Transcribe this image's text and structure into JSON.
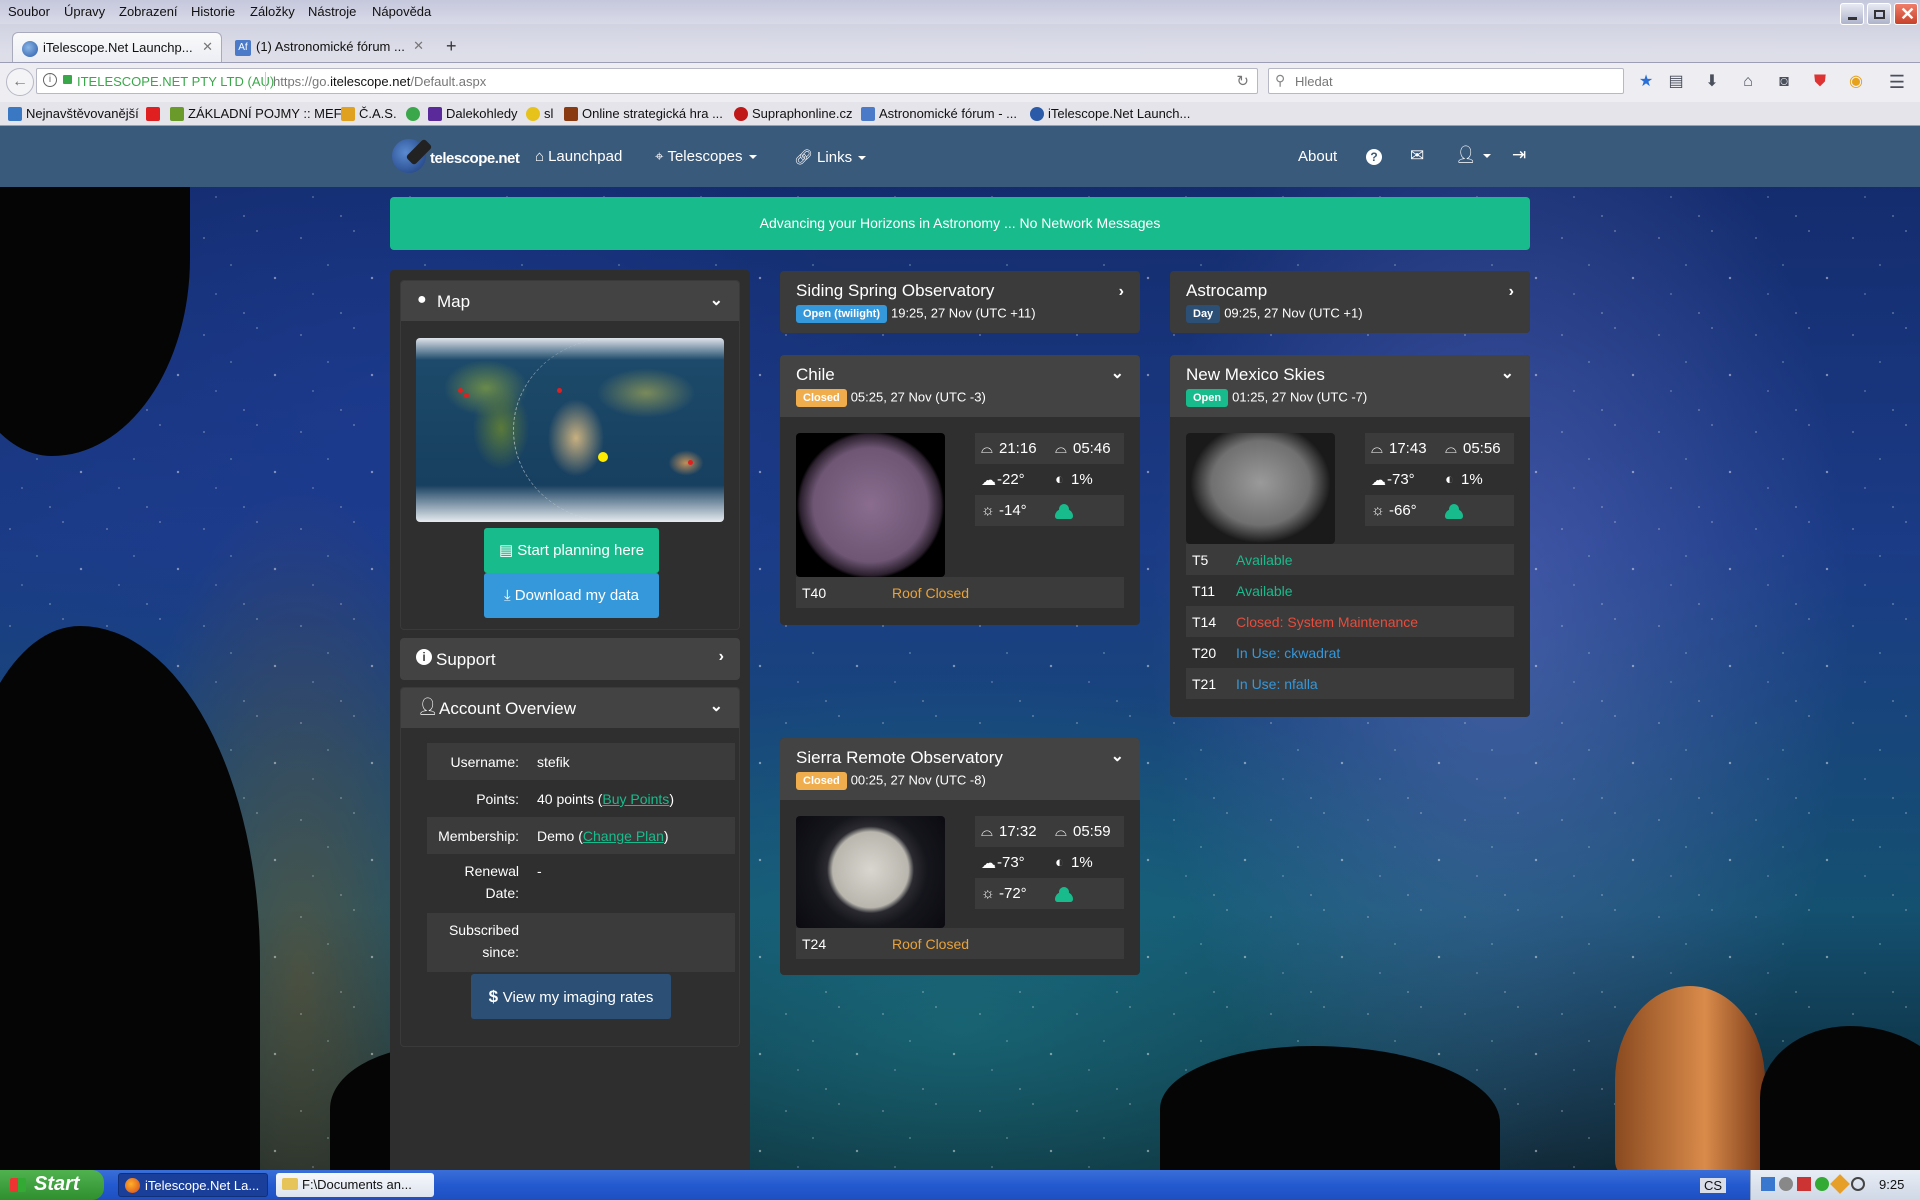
{
  "browser": {
    "menu": [
      "Soubor",
      "Úpravy",
      "Zobrazení",
      "Historie",
      "Záložky",
      "Nástroje",
      "Nápověda"
    ],
    "tabs": [
      {
        "label": "iTelescope.Net Launchp...",
        "active": true
      },
      {
        "label": "(1) Astronomické fórum ...",
        "active": false
      }
    ],
    "new_tab": "+",
    "identity": "ITELESCOPE.NET PTY LTD (AU)",
    "url_prefix": "https://go.",
    "url_domain": "itelescope.net",
    "url_path": "/Default.aspx",
    "search_placeholder": "Hledat",
    "bookmarks": [
      {
        "label": "Nejnavštěvovanější",
        "color": "#3b78c4"
      },
      {
        "label": "",
        "color": "#e02020"
      },
      {
        "label": "ZÁKLADNÍ POJMY :: MEF",
        "color": "#6a9a2a"
      },
      {
        "label": "Č.A.S.",
        "color": "#e0a020"
      },
      {
        "label": "",
        "color": "#3aa84a"
      },
      {
        "label": "Dalekohledy",
        "color": "#5a2a9a"
      },
      {
        "label": "sl",
        "color": "#e6c21a"
      },
      {
        "label": "Online strategická hra ...",
        "color": "#8a3a10"
      },
      {
        "label": "Supraphonline.cz",
        "color": "#c01818"
      },
      {
        "label": "Astronomické fórum - ...",
        "color": "#4a7ac8"
      },
      {
        "label": "iTelescope.Net Launch...",
        "color": "#2a5aa8"
      }
    ]
  },
  "nav": {
    "logo_text": "telescope.net",
    "items": [
      {
        "label": "Launchpad",
        "icon": "home-icon"
      },
      {
        "label": "Telescopes",
        "icon": "telescope-icon",
        "dropdown": true
      },
      {
        "label": "Links",
        "icon": "link-icon",
        "dropdown": true
      }
    ],
    "right": {
      "about": "About"
    }
  },
  "banner": "Advancing your Horizons in Astronomy ... No Network Messages",
  "sidebar": {
    "map_title": "Map",
    "start_planning": "Start planning here",
    "download_data": "Download my data",
    "support_title": "Support",
    "account_title": "Account Overview",
    "account": {
      "username_label": "Username:",
      "username": "stefik",
      "points_label": "Points:",
      "points_value": "40 points (",
      "buy_points": "Buy Points",
      "close_paren": ")",
      "membership_label": "Membership:",
      "membership_value": "Demo (",
      "change_plan": "Change Plan",
      "renewal_label_1": "Renewal",
      "renewal_label_2": "Date:",
      "renewal_value": "-",
      "subscribed_label_1": "Subscribed",
      "subscribed_label_2": "since:",
      "subscribed_value": ""
    },
    "view_rates": "View my imaging rates"
  },
  "observatories": {
    "siding": {
      "name": "Siding Spring Observatory",
      "status": "Open (twilight)",
      "status_color": "#3498db",
      "time": "19:25, 27 Nov (UTC +11)"
    },
    "astrocamp": {
      "name": "Astrocamp",
      "status": "Day",
      "status_color": "#2c4f75",
      "time": "09:25, 27 Nov (UTC +1)"
    },
    "chile": {
      "name": "Chile",
      "status": "Closed",
      "status_color": "#f0ad4e",
      "time": "05:25, 27 Nov (UTC -3)",
      "weather": {
        "sunset": "21:16",
        "sunrise": "05:46",
        "sun_alt": "-22°",
        "moon": "1%",
        "sky": "-14°"
      },
      "telescopes": [
        {
          "id": "T40",
          "status": "Roof Closed",
          "color": "#e8a33c"
        }
      ]
    },
    "newmexico": {
      "name": "New Mexico Skies",
      "status": "Open",
      "status_color": "#18bc8c",
      "time": "01:25, 27 Nov (UTC -7)",
      "weather": {
        "sunset": "17:43",
        "sunrise": "05:56",
        "sun_alt": "-73°",
        "moon": "1%",
        "sky": "-66°"
      },
      "telescopes": [
        {
          "id": "T5",
          "status": "Available",
          "color": "#18bc8c"
        },
        {
          "id": "T11",
          "status": "Available",
          "color": "#18bc8c"
        },
        {
          "id": "T14",
          "status": "Closed: System Maintenance",
          "color": "#e74c3c"
        },
        {
          "id": "T20",
          "status": "In Use: ckwadrat",
          "color": "#3498db"
        },
        {
          "id": "T21",
          "status": "In Use: nfalla",
          "color": "#3498db"
        }
      ]
    },
    "sierra": {
      "name": "Sierra Remote Observatory",
      "status": "Closed",
      "status_color": "#f0ad4e",
      "time": "00:25, 27 Nov (UTC -8)",
      "weather": {
        "sunset": "17:32",
        "sunrise": "05:59",
        "sun_alt": "-73°",
        "moon": "1%",
        "sky": "-72°"
      },
      "telescopes": [
        {
          "id": "T24",
          "status": "Roof Closed",
          "color": "#e8a33c"
        }
      ]
    }
  },
  "taskbar": {
    "start": "Start",
    "tasks": [
      "iTelescope.Net La...",
      "F:\\Documents an..."
    ],
    "lang": "CS",
    "clock": "9:25"
  }
}
